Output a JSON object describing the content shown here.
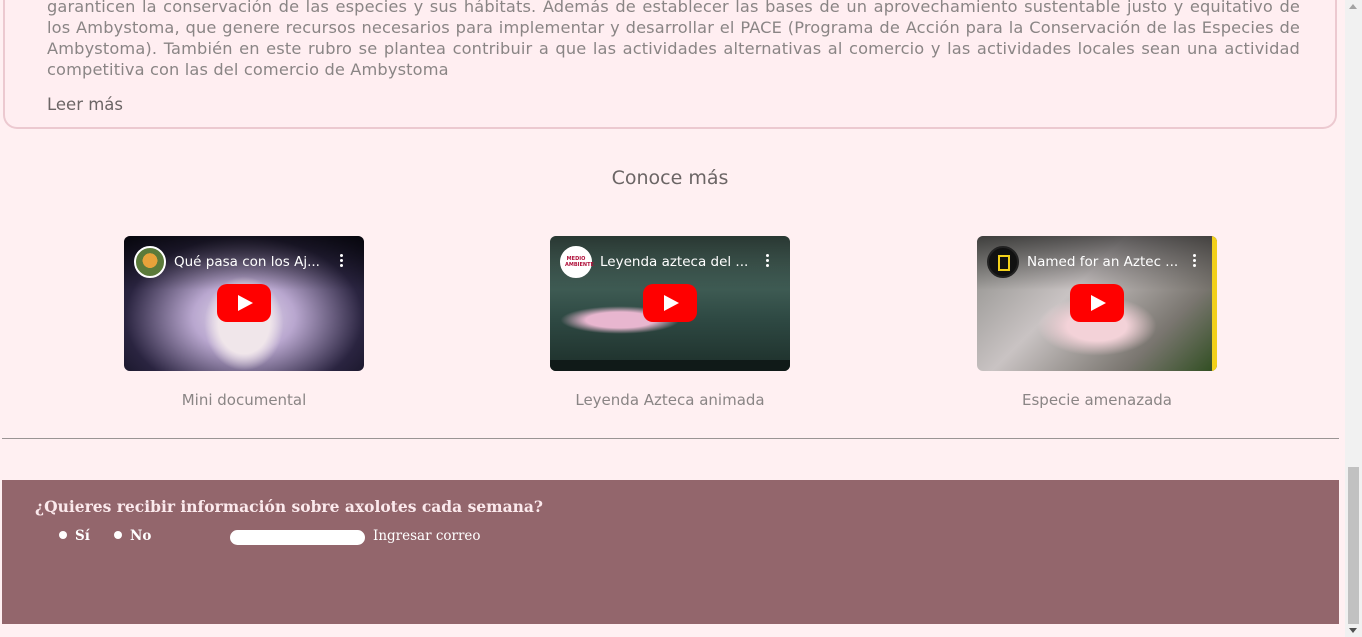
{
  "info": {
    "paragraph": "garanticen la conservación de las especies y sus hábitats. Además de establecer las bases de un aprovechamiento sustentable justo y equitativo de los Ambystoma, que genere recursos necesarios para implementar y desarrollar el PACE (Programa de Acción para la Conservación de las Especies de Ambystoma). También en este rubro se plantea contribuir a que las actividades alternativas al comercio y las actividades locales sean una actividad competitiva con las del comercio de Ambystoma",
    "read_more": "Leer más"
  },
  "section": {
    "title": "Conoce más"
  },
  "videos": [
    {
      "title": "Qué pasa con los Aj...",
      "caption": "Mini documental",
      "channel_icon": "channel-avatar-icon"
    },
    {
      "title": "Leyenda azteca del ...",
      "caption": "Leyenda Azteca animada",
      "channel_icon": "medio-ambiente-logo-icon",
      "channel_text": "MEDIO AMBIENTE"
    },
    {
      "title": "Named for an Aztec ...",
      "caption": "Especie amenazada",
      "channel_icon": "nat-geo-logo-icon"
    }
  ],
  "newsletter": {
    "question": "¿Quieres recibir información sobre axolotes cada semana?",
    "option_yes": "Sí",
    "option_no": "No",
    "email_label": "Ingresar correo",
    "email_value": ""
  },
  "colors": {
    "page_bg": "#fff0f2",
    "footer_bg": "#93666c",
    "play_button": "#ff0000"
  }
}
